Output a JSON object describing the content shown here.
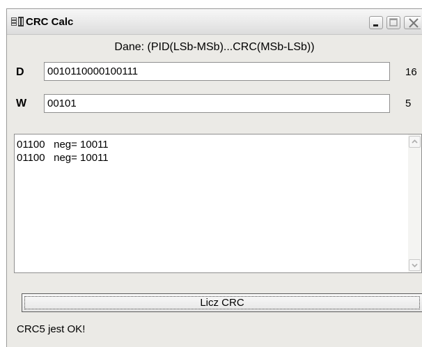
{
  "window": {
    "title": "CRC Calc",
    "title_icon": "app-icon",
    "controls": [
      "minimize-icon",
      "maximize-icon",
      "close-icon"
    ]
  },
  "caption": "Dane: (PID(LSb-MSb)...CRC(MSb-LSb))",
  "fields": {
    "d": {
      "label": "D",
      "value": "0010110000100111",
      "count": "16"
    },
    "w": {
      "label": "W",
      "value": "00101",
      "count": "5"
    }
  },
  "output": {
    "lines": [
      "01100   neg= 10011",
      "01100   neg= 10011"
    ]
  },
  "button": {
    "label": "Licz CRC"
  },
  "status": "CRC5 jest OK!"
}
